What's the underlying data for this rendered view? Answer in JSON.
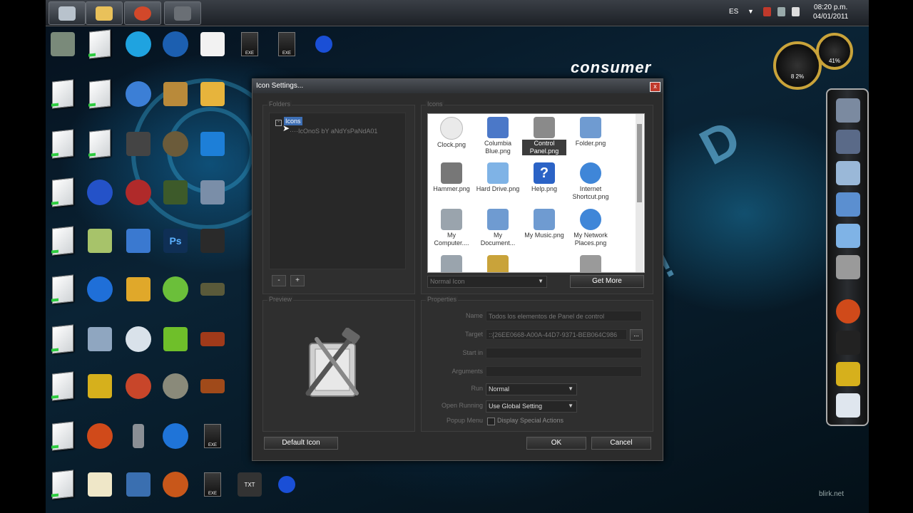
{
  "taskbar": {
    "apps": [
      {
        "icon": "counter-strike-icon",
        "color": "#b8c2cc"
      },
      {
        "icon": "file-explorer-icon",
        "color": "#e9c15a"
      },
      {
        "icon": "media-player-icon",
        "color": "#d2482a"
      },
      {
        "icon": "video-camera-icon",
        "color": "#6a6f75"
      }
    ],
    "language": "ES",
    "time": "08:20 p.m.",
    "date": "04/01/2011"
  },
  "gauges": {
    "left": "8 2%",
    "right": "41%"
  },
  "brand_text": "consumer",
  "watermark": "blirk.net",
  "dialog": {
    "title": "Icon Settings...",
    "close_label": "x",
    "folders": {
      "label": "Folders",
      "root": "Icons",
      "child": "IcOnoS bY aNdYsPaNdA01",
      "remove_label": "-",
      "add_label": "+"
    },
    "icons": {
      "label": "Icons",
      "items": [
        {
          "label": "Clock.png",
          "icon": "clock-icon",
          "color": "#e5e5e5"
        },
        {
          "label": "Columbia Blue.png",
          "icon": "rocket-icon",
          "color": "#4b78c8"
        },
        {
          "label": "Control Panel.png",
          "icon": "control-panel-icon",
          "color": "#8a8a8a",
          "selected": true
        },
        {
          "label": "Folder.png",
          "icon": "folder-icon",
          "color": "#6f9bd1"
        },
        {
          "label": "Hammer.png",
          "icon": "hammer-icon",
          "color": "#777777"
        },
        {
          "label": "Hard Drive.png",
          "icon": "hard-drive-icon",
          "color": "#7fb3e6"
        },
        {
          "label": "Help.png",
          "icon": "help-icon",
          "color": "#2b63c6"
        },
        {
          "label": "Internet Shortcut.png",
          "icon": "globe-icon",
          "color": "#3f86d8"
        },
        {
          "label": "My Computer....",
          "icon": "computer-icon",
          "color": "#9aa4ad"
        },
        {
          "label": "My Document...",
          "icon": "documents-folder-icon",
          "color": "#6f9bd1"
        },
        {
          "label": "My Music.png",
          "icon": "music-folder-icon",
          "color": "#6f9bd1"
        },
        {
          "label": "My Network Places.png",
          "icon": "network-icon",
          "color": "#3f86d8"
        },
        {
          "label": "",
          "icon": "computer-icon",
          "color": "#9aa4ad"
        },
        {
          "label": "",
          "icon": "recent-folder-icon",
          "color": "#c9a33a"
        },
        {
          "label": "",
          "icon": "sliders-icon",
          "color": "#9a9a9a"
        }
      ],
      "mode": "Normal Icon",
      "get_more_label": "Get More"
    },
    "preview": {
      "label": "Preview"
    },
    "properties": {
      "label": "Properties",
      "name_label": "Name",
      "name_value": "Todos los elementos de Panel de control",
      "target_label": "Target",
      "target_value": "::{26EE0668-A00A-44D7-9371-BEB064C986",
      "browse_label": "...",
      "start_in_label": "Start in",
      "start_in_value": "",
      "arguments_label": "Arguments",
      "arguments_value": "",
      "run_label": "Run",
      "run_value": "Normal",
      "open_running_label": "Open Running",
      "open_running_value": "Use Global Setting",
      "popup_menu_label": "Popup Menu",
      "popup_menu_checkbox": "Display Special Actions"
    },
    "default_icon_label": "Default Icon",
    "ok_label": "OK",
    "cancel_label": "Cancel"
  }
}
